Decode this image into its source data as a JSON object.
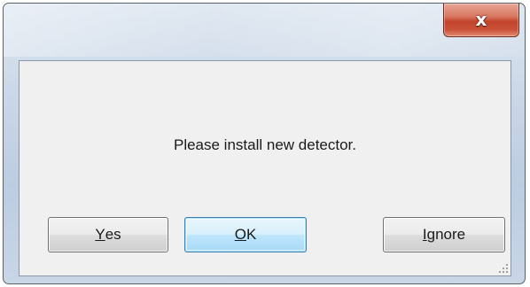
{
  "window": {
    "title": "",
    "close_icon": "close-icon",
    "close_glyph": "x"
  },
  "dialog": {
    "message": "Please install new detector."
  },
  "buttons": {
    "yes": {
      "mnemonic": "Y",
      "rest": "es",
      "label": "Yes"
    },
    "ok": {
      "mnemonic": "O",
      "rest": "K",
      "label": "OK"
    },
    "ignore": {
      "mnemonic": "I",
      "rest": "gnore",
      "label": "Ignore"
    }
  },
  "colors": {
    "close_button": "#c9533a",
    "default_button_border": "#3c7fb1",
    "client_background": "#f0f0f0"
  }
}
